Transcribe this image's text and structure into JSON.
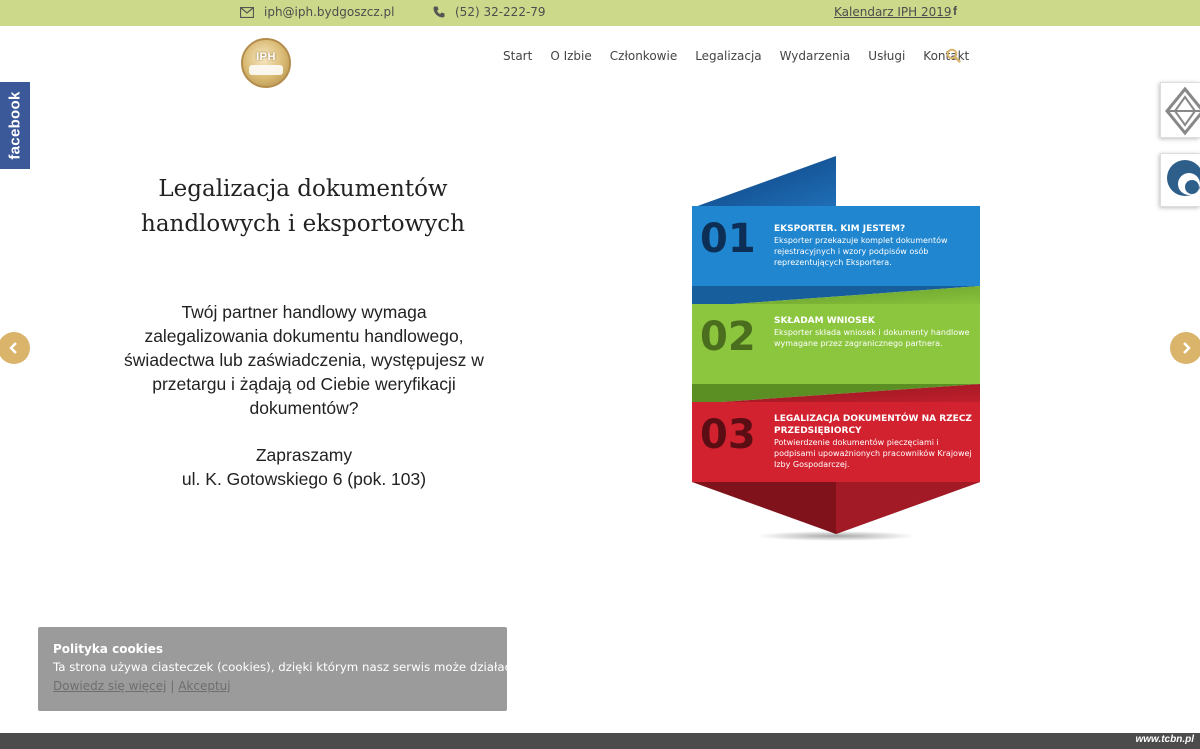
{
  "topbar": {
    "email": "iph@iph.bydgoszcz.pl",
    "phone": "(52) 32-222-79",
    "calendar_link": "Kalendarz IPH 2019",
    "facebook_glyph": "f",
    "icons": {
      "email": "envelope-icon",
      "phone": "phone-icon",
      "social": "facebook-icon"
    }
  },
  "header": {
    "logo_text": "IPH",
    "nav": [
      "Start",
      "O Izbie",
      "Członkowie",
      "Legalizacja",
      "Wydarzenia",
      "Usługi",
      "Kontakt"
    ],
    "search_icon": "search-icon"
  },
  "side": {
    "facebook_label": "facebook"
  },
  "slide": {
    "title": "Legalizacja dokumentów handlowych i eksportowych",
    "text": "Twój partner handlowy wymaga zalegalizowania dokumentu handlowego, świadectwa lub zaświadczenia, występujesz w przetargu i żądają od Ciebie weryfikacji dokumentów?",
    "invite_line1": "Zapraszamy",
    "invite_line2": "ul. K. Gotowskiego 6 (pok. 103)"
  },
  "steps": [
    {
      "number": "01",
      "heading": "EKSPORTER. KIM JESTEM?",
      "body": "Eksporter przekazuje komplet dokumentów rejestracyjnych i wzory podpisów osób reprezentujących Eksportera.",
      "color": "#1f86cf"
    },
    {
      "number": "02",
      "heading": "SKŁADAM WNIOSEK",
      "body": "Eksporter składa wniosek i dokumenty handlowe wymagane przez zagranicznego partnera.",
      "color": "#8cc63e"
    },
    {
      "number": "03",
      "heading": "LEGALIZACJA DOKUMENTÓW NA RZECZ PRZEDSIĘBIORCY",
      "body": "Potwierdzenie dokumentów pieczęciami i podpisami upoważnionych pracowników Krajowej Izby Gospodarczej.",
      "color": "#d2222f"
    }
  ],
  "cookies": {
    "title": "Polityka cookies",
    "text": "Ta strona używa ciasteczek (cookies), dzięki którym nasz serwis może działać lepiej.",
    "more_link": "Dowiedz się więcej",
    "separator": "|",
    "accept_link": "Akceptuj"
  },
  "footer": {
    "credit": "www.tcbn.pl"
  },
  "colors": {
    "topbar_bg": "#cdd98a",
    "accent_gold": "#d9b46a",
    "facebook_blue": "#3b5998"
  }
}
